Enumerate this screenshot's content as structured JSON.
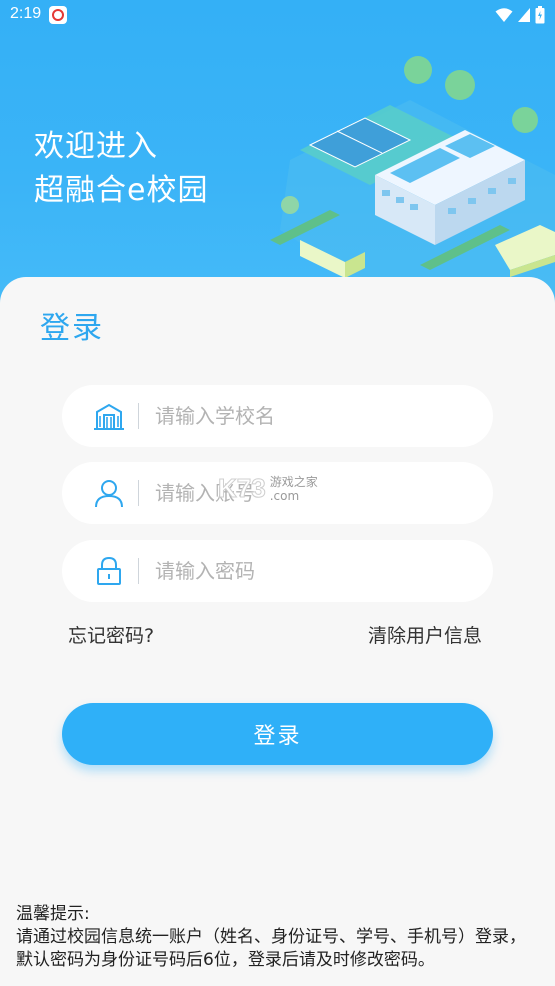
{
  "status_bar": {
    "time": "2:19"
  },
  "hero": {
    "line1": "欢迎进入",
    "line2": "超融合e校园"
  },
  "login": {
    "title": "登录",
    "school_placeholder": "请输入学校名",
    "username_placeholder": "请输入账号",
    "password_placeholder": "请输入密码",
    "forgot_password": "忘记密码?",
    "clear_user_info": "清除用户信息",
    "submit_label": "登录"
  },
  "tips": {
    "heading": "温馨提示:",
    "body": "请通过校园信息统一账户（姓名、身份证号、学号、手机号）登录，默认密码为身份证号码后6位，登录后请及时修改密码。"
  },
  "watermark": {
    "brand": "K73",
    "sub1": "游戏之家",
    "sub2": ".com"
  },
  "colors": {
    "accent": "#2fb0f8",
    "title": "#2ea7ef",
    "hero_bg": "#34b0f6"
  }
}
